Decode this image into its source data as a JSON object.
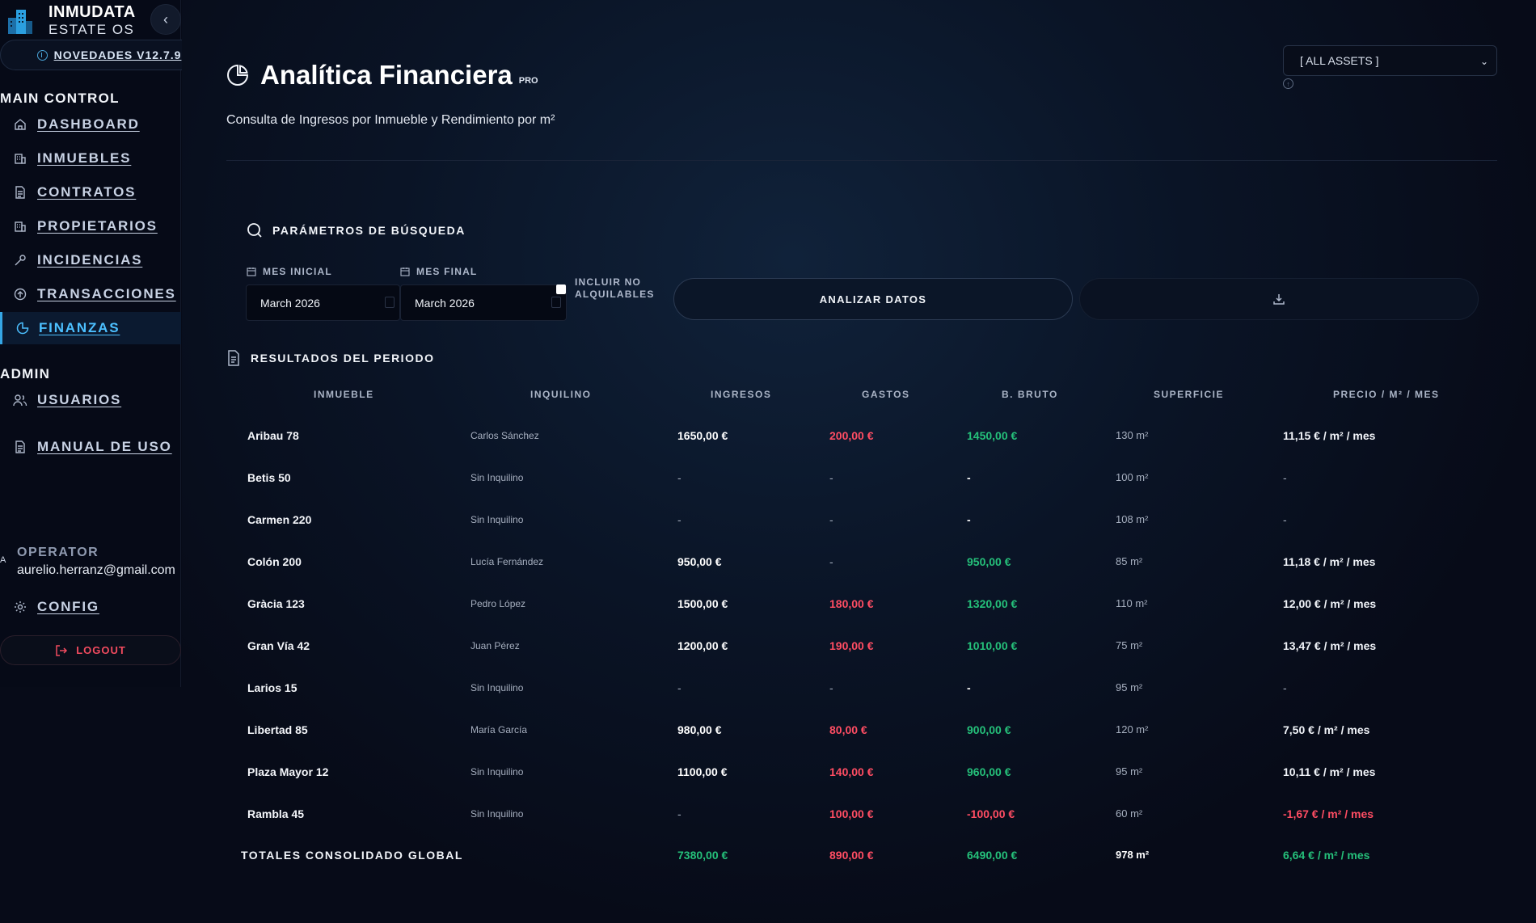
{
  "brand": {
    "name": "INMUDATA",
    "subtitle": "ESTATE OS"
  },
  "news": {
    "label": "NOVEDADES V12.7.9"
  },
  "sidebar": {
    "main_section": "MAIN CONTROL",
    "items": [
      {
        "label": "DASHBOARD",
        "icon": "home-icon"
      },
      {
        "label": "INMUEBLES",
        "icon": "building-icon"
      },
      {
        "label": "CONTRATOS",
        "icon": "document-icon"
      },
      {
        "label": "PROPIETARIOS",
        "icon": "building-icon"
      },
      {
        "label": "INCIDENCIAS",
        "icon": "wrench-icon"
      },
      {
        "label": "TRANSACCIONES",
        "icon": "arrow-up-circle-icon"
      },
      {
        "label": "FINANZAS",
        "icon": "pie-chart-icon",
        "active": true
      }
    ],
    "admin_section": "ADMIN",
    "admin_items": [
      {
        "label": "USUARIOS",
        "icon": "users-icon"
      },
      {
        "label": "MANUAL DE USO",
        "icon": "document-icon"
      }
    ],
    "operator": {
      "label": "OPERATOR",
      "avatar": "A",
      "email": "aurelio.herranz@gmail.com"
    },
    "config_label": "CONFIG",
    "logout_label": "LOGOUT"
  },
  "header": {
    "title": "Analítica Financiera",
    "badge": "PRO",
    "subtitle": "Consulta de Ingresos por Inmueble y Rendimiento por m²",
    "asset_filter": "[ ALL ASSETS ]"
  },
  "params": {
    "title": "PARÁMETROS DE BÚSQUEDA",
    "start_label": "MES INICIAL",
    "start_value": "March 2026",
    "end_label": "MES FINAL",
    "end_value": "March 2026",
    "include_label_1": "INCLUIR NO",
    "include_label_2": "ALQUILABLES",
    "analyze_label": "ANALIZAR DATOS"
  },
  "results": {
    "title": "RESULTADOS DEL PERIODO",
    "columns": [
      "INMUEBLE",
      "INQUILINO",
      "INGRESOS",
      "GASTOS",
      "B. BRUTO",
      "SUPERFICIE",
      "PRECIO / M² / MES"
    ],
    "rows": [
      {
        "inmueble": "Aribau 78",
        "inquilino": "Carlos Sánchez",
        "ingresos": "1650,00 €",
        "gastos": "200,00 €",
        "bruto": "1450,00 €",
        "superficie": "130 m²",
        "precio": "11,15 € / m² / mes",
        "g": "red",
        "b": "green",
        "p": "normal"
      },
      {
        "inmueble": "Betis 50",
        "inquilino": "Sin Inquilino",
        "ingresos": "-",
        "gastos": "-",
        "bruto": "-",
        "superficie": "100 m²",
        "precio": "-",
        "g": "dash",
        "b": "dashw",
        "p": "dash"
      },
      {
        "inmueble": "Carmen 220",
        "inquilino": "Sin Inquilino",
        "ingresos": "-",
        "gastos": "-",
        "bruto": "-",
        "superficie": "108 m²",
        "precio": "-",
        "g": "dash",
        "b": "dashw",
        "p": "dash"
      },
      {
        "inmueble": "Colón 200",
        "inquilino": "Lucía Fernández",
        "ingresos": "950,00 €",
        "gastos": "-",
        "bruto": "950,00 €",
        "superficie": "85 m²",
        "precio": "11,18 € / m² / mes",
        "g": "dash",
        "b": "green",
        "p": "normal"
      },
      {
        "inmueble": "Gràcia 123",
        "inquilino": "Pedro López",
        "ingresos": "1500,00 €",
        "gastos": "180,00 €",
        "bruto": "1320,00 €",
        "superficie": "110 m²",
        "precio": "12,00 € / m² / mes",
        "g": "red",
        "b": "green",
        "p": "normal"
      },
      {
        "inmueble": "Gran Vía 42",
        "inquilino": "Juan Pérez",
        "ingresos": "1200,00 €",
        "gastos": "190,00 €",
        "bruto": "1010,00 €",
        "superficie": "75 m²",
        "precio": "13,47 € / m² / mes",
        "g": "red",
        "b": "green",
        "p": "normal"
      },
      {
        "inmueble": "Larios 15",
        "inquilino": "Sin Inquilino",
        "ingresos": "-",
        "gastos": "-",
        "bruto": "-",
        "superficie": "95 m²",
        "precio": "-",
        "g": "dash",
        "b": "dashw",
        "p": "dash"
      },
      {
        "inmueble": "Libertad 85",
        "inquilino": "María García",
        "ingresos": "980,00 €",
        "gastos": "80,00 €",
        "bruto": "900,00 €",
        "superficie": "120 m²",
        "precio": "7,50 € / m² / mes",
        "g": "red",
        "b": "green",
        "p": "normal"
      },
      {
        "inmueble": "Plaza Mayor 12",
        "inquilino": "Sin Inquilino",
        "ingresos": "1100,00 €",
        "gastos": "140,00 €",
        "bruto": "960,00 €",
        "superficie": "95 m²",
        "precio": "10,11 € / m² / mes",
        "g": "red",
        "b": "green",
        "p": "normal"
      },
      {
        "inmueble": "Rambla 45",
        "inquilino": "Sin Inquilino",
        "ingresos": "-",
        "gastos": "100,00 €",
        "bruto": "-100,00 €",
        "superficie": "60 m²",
        "precio": "-1,67 € / m² / mes",
        "g": "red",
        "b": "red",
        "p": "red"
      }
    ],
    "totals": {
      "label": "TOTALES CONSOLIDADO GLOBAL",
      "ingresos": "7380,00 €",
      "gastos": "890,00 €",
      "bruto": "6490,00 €",
      "superficie": "978 m²",
      "precio": "6,64 € / m² / mes"
    }
  },
  "colors": {
    "accent": "#4cc0ff",
    "positive": "#25c07a",
    "negative": "#ff4d63",
    "background": "#070b18"
  }
}
